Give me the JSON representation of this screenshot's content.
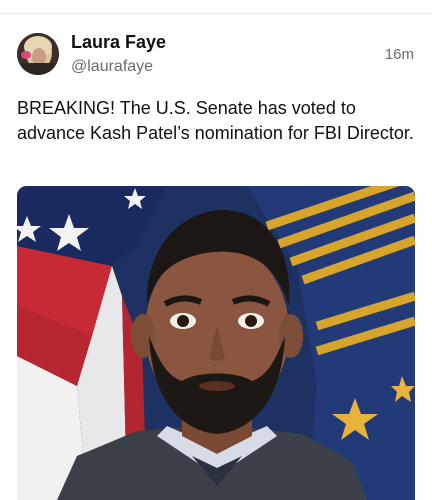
{
  "post": {
    "author_name": "Laura Faye",
    "author_handle": "@laurafaye",
    "time_ago": "16m",
    "body_text": "BREAKING! The U.S. Senate has voted to advance Kash Patel’s nomination for FBI Director.",
    "avatar_icon": "profile-avatar",
    "photo_icon": "portrait-photo"
  }
}
